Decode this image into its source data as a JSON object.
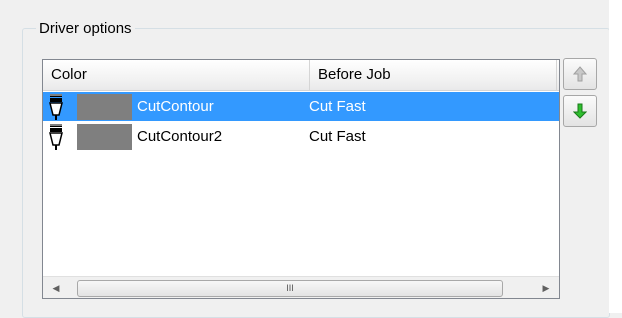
{
  "group": {
    "label": "Driver options"
  },
  "list": {
    "columns": [
      "Color",
      "Before Job"
    ],
    "rows": [
      {
        "color": "#7f7f7f",
        "name": "CutContour",
        "before_job": "Cut Fast",
        "selected": true,
        "icon": "pen-tool-icon"
      },
      {
        "color": "#7f7f7f",
        "name": "CutContour2",
        "before_job": "Cut Fast",
        "selected": false,
        "icon": "pen-tool-icon"
      }
    ]
  },
  "scrollbar": {
    "thumb_grip": "III"
  },
  "buttons": {
    "move_up": "arrow-up-icon",
    "move_down": "arrow-down-icon"
  },
  "colors": {
    "selection": "#3399ff",
    "down_arrow": "#22aa22",
    "up_arrow_disabled": "#a0a0a0"
  }
}
